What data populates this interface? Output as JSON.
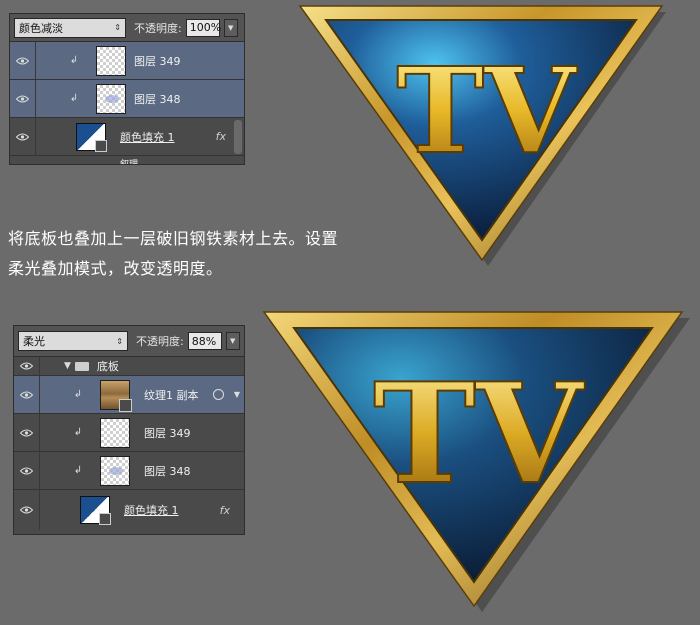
{
  "panel1": {
    "blend_mode": "颜色减淡",
    "opacity_label": "不透明度:",
    "opacity_value": "100%",
    "layers": [
      {
        "name": "图层 349"
      },
      {
        "name": "图层 348"
      },
      {
        "name": "颜色填充 1",
        "fx": "fx"
      },
      {
        "name": "叙理"
      }
    ]
  },
  "description": {
    "line1": "将底板也叠加上一层破旧钢铁素材上去。设置",
    "line2": "柔光叠加模式，改变透明度。"
  },
  "panel2": {
    "blend_mode": "柔光",
    "opacity_label": "不透明度:",
    "opacity_value": "88%",
    "layers": [
      {
        "name": "底板"
      },
      {
        "name": "纹理1 副本"
      },
      {
        "name": "图层 349"
      },
      {
        "name": "图层 348"
      },
      {
        "name": "颜色填充 1",
        "fx": "fx"
      }
    ]
  },
  "logo1": {
    "text": "TV"
  },
  "logo2": {
    "text": "TV"
  },
  "colors": {
    "gold": "#d4a42a",
    "blue": "#1d4c86",
    "selected_row": "#5b6a82"
  }
}
